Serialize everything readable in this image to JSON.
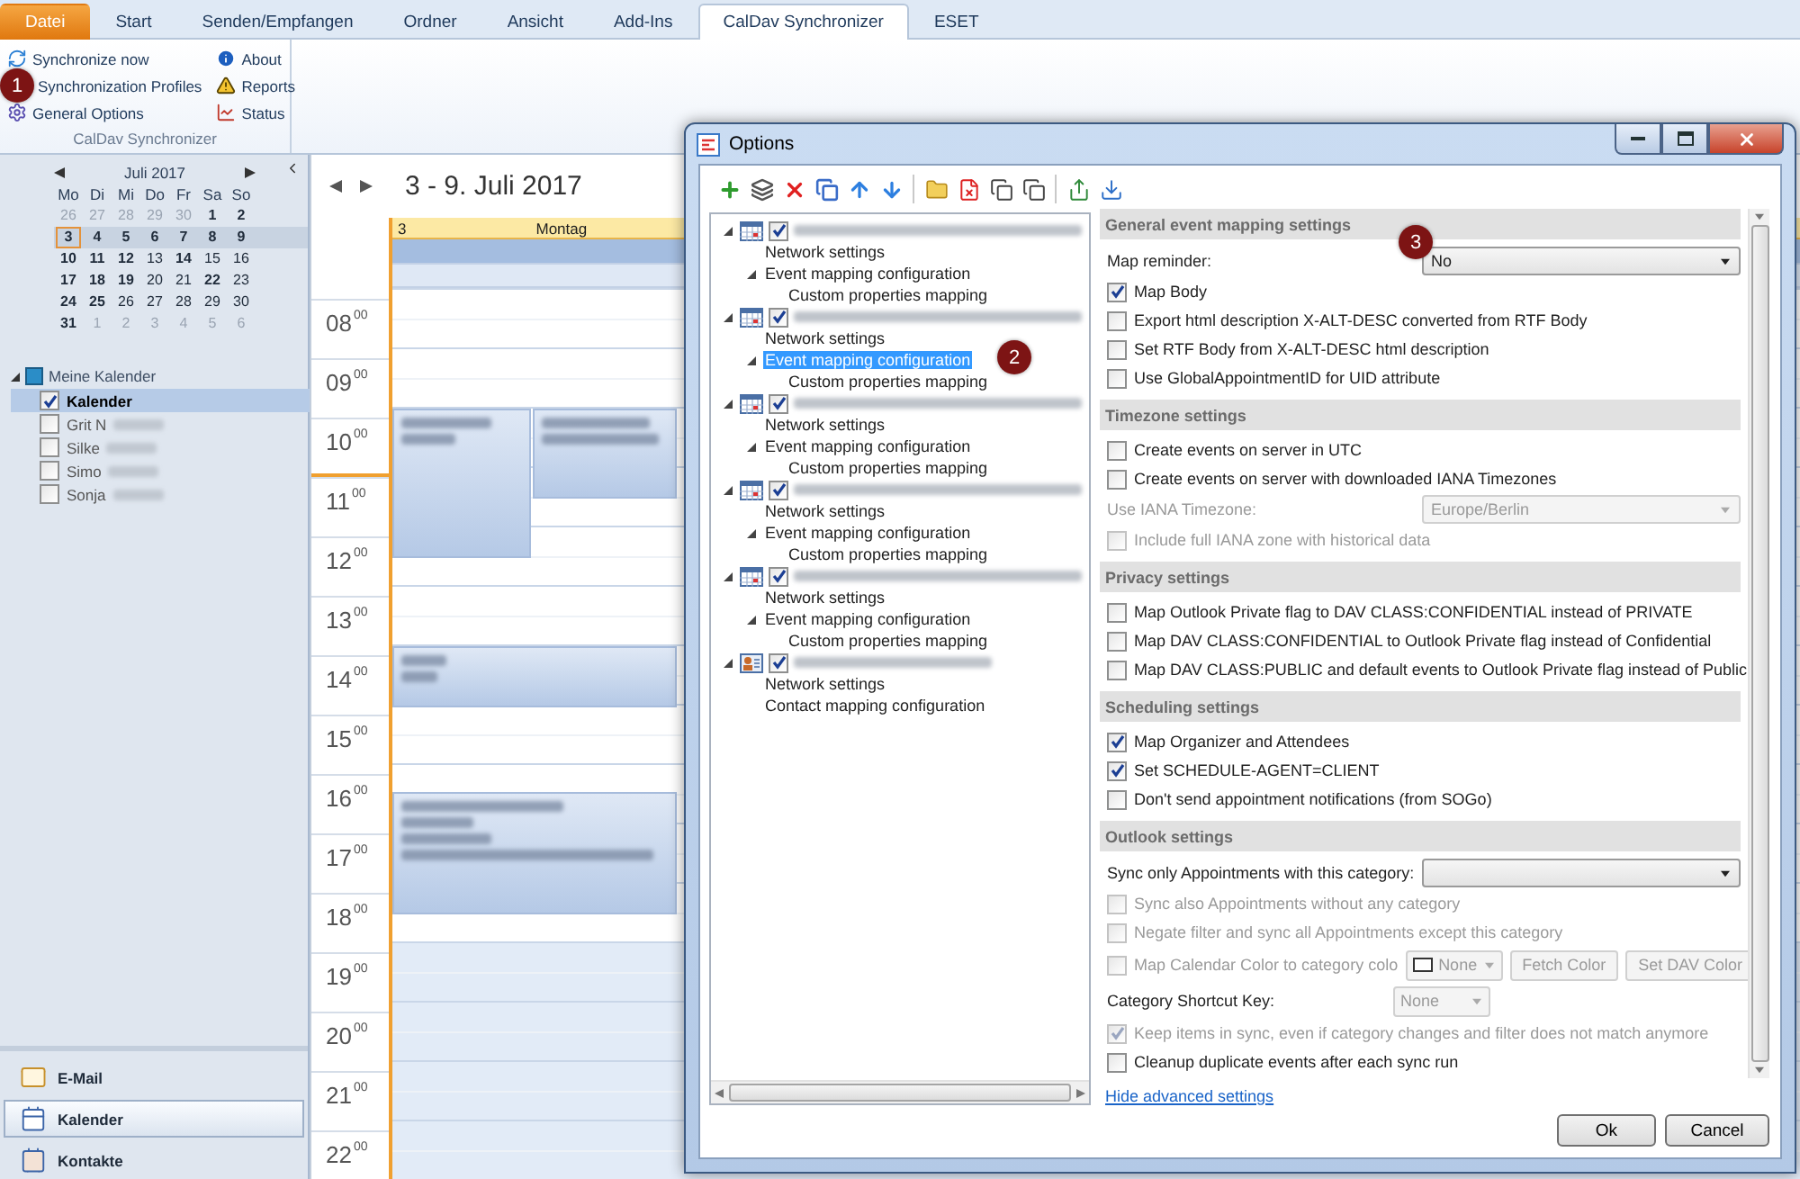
{
  "ribbon": {
    "tabs": [
      {
        "label": "Datei",
        "kind": "file",
        "selected": false
      },
      {
        "label": "Start",
        "kind": "tab",
        "selected": false
      },
      {
        "label": "Senden/Empfangen",
        "kind": "tab",
        "selected": false
      },
      {
        "label": "Ordner",
        "kind": "tab",
        "selected": false
      },
      {
        "label": "Ansicht",
        "kind": "tab",
        "selected": false
      },
      {
        "label": "Add-Ins",
        "kind": "tab",
        "selected": false
      },
      {
        "label": "CalDav Synchronizer",
        "kind": "tab",
        "selected": true
      },
      {
        "label": "ESET",
        "kind": "tab",
        "selected": false
      }
    ],
    "group": {
      "title": "CalDav Synchronizer",
      "items": [
        {
          "label": "Synchronize now"
        },
        {
          "label": "Synchronization Profiles"
        },
        {
          "label": "General Options"
        },
        {
          "label": "About"
        },
        {
          "label": "Reports"
        },
        {
          "label": "Status"
        }
      ]
    }
  },
  "callouts": [
    "1",
    "2",
    "3"
  ],
  "navigation": {
    "mini_calendar": {
      "month": "Juli 2017",
      "weekdays": [
        "Mo",
        "Di",
        "Mi",
        "Do",
        "Fr",
        "Sa",
        "So"
      ],
      "weeks": [
        {
          "selected": false,
          "days": [
            {
              "day": "26",
              "muted": true,
              "bold": false,
              "today": false
            },
            {
              "day": "27",
              "muted": true,
              "bold": false,
              "today": false
            },
            {
              "day": "28",
              "muted": true,
              "bold": false,
              "today": false
            },
            {
              "day": "29",
              "muted": true,
              "bold": false,
              "today": false
            },
            {
              "day": "30",
              "muted": true,
              "bold": false,
              "today": false
            },
            {
              "day": "1",
              "muted": false,
              "bold": true,
              "today": false
            },
            {
              "day": "2",
              "muted": false,
              "bold": true,
              "today": false
            }
          ]
        },
        {
          "selected": true,
          "days": [
            {
              "day": "3",
              "muted": false,
              "bold": true,
              "today": true
            },
            {
              "day": "4",
              "muted": false,
              "bold": true,
              "today": false
            },
            {
              "day": "5",
              "muted": false,
              "bold": true,
              "today": false
            },
            {
              "day": "6",
              "muted": false,
              "bold": true,
              "today": false
            },
            {
              "day": "7",
              "muted": false,
              "bold": true,
              "today": false
            },
            {
              "day": "8",
              "muted": false,
              "bold": true,
              "today": false
            },
            {
              "day": "9",
              "muted": false,
              "bold": true,
              "today": false
            }
          ]
        },
        {
          "selected": false,
          "days": [
            {
              "day": "10",
              "muted": false,
              "bold": true,
              "today": false
            },
            {
              "day": "11",
              "muted": false,
              "bold": true,
              "today": false
            },
            {
              "day": "12",
              "muted": false,
              "bold": true,
              "today": false
            },
            {
              "day": "13",
              "muted": false,
              "bold": false,
              "today": false
            },
            {
              "day": "14",
              "muted": false,
              "bold": true,
              "today": false
            },
            {
              "day": "15",
              "muted": false,
              "bold": false,
              "today": false
            },
            {
              "day": "16",
              "muted": false,
              "bold": false,
              "today": false
            }
          ]
        },
        {
          "selected": false,
          "days": [
            {
              "day": "17",
              "muted": false,
              "bold": true,
              "today": false
            },
            {
              "day": "18",
              "muted": false,
              "bold": true,
              "today": false
            },
            {
              "day": "19",
              "muted": false,
              "bold": true,
              "today": false
            },
            {
              "day": "20",
              "muted": false,
              "bold": false,
              "today": false
            },
            {
              "day": "21",
              "muted": false,
              "bold": false,
              "today": false
            },
            {
              "day": "22",
              "muted": false,
              "bold": true,
              "today": false
            },
            {
              "day": "23",
              "muted": false,
              "bold": false,
              "today": false
            }
          ]
        },
        {
          "selected": false,
          "days": [
            {
              "day": "24",
              "muted": false,
              "bold": true,
              "today": false
            },
            {
              "day": "25",
              "muted": false,
              "bold": true,
              "today": false
            },
            {
              "day": "26",
              "muted": false,
              "bold": false,
              "today": false
            },
            {
              "day": "27",
              "muted": false,
              "bold": false,
              "today": false
            },
            {
              "day": "28",
              "muted": false,
              "bold": false,
              "today": false
            },
            {
              "day": "29",
              "muted": false,
              "bold": false,
              "today": false
            },
            {
              "day": "30",
              "muted": false,
              "bold": false,
              "today": false
            }
          ]
        },
        {
          "selected": false,
          "days": [
            {
              "day": "31",
              "muted": false,
              "bold": true,
              "today": false
            },
            {
              "day": "1",
              "muted": true,
              "bold": false,
              "today": false
            },
            {
              "day": "2",
              "muted": true,
              "bold": false,
              "today": false
            },
            {
              "day": "3",
              "muted": true,
              "bold": false,
              "today": false
            },
            {
              "day": "4",
              "muted": true,
              "bold": false,
              "today": false
            },
            {
              "day": "5",
              "muted": true,
              "bold": false,
              "today": false
            },
            {
              "day": "6",
              "muted": true,
              "bold": false,
              "today": false
            }
          ]
        }
      ]
    },
    "folders": {
      "title": "Meine Kalender",
      "expanded": true,
      "items": [
        {
          "label": "Kalender",
          "checked": true,
          "selected": true,
          "redacted": false
        },
        {
          "label": "Grit N",
          "checked": false,
          "selected": false,
          "redacted": true
        },
        {
          "label": "Silke",
          "checked": false,
          "selected": false,
          "redacted": true
        },
        {
          "label": "Simo",
          "checked": false,
          "selected": false,
          "redacted": true
        },
        {
          "label": "Sonja",
          "checked": false,
          "selected": false,
          "redacted": true
        }
      ]
    },
    "modules": [
      {
        "label": "E-Mail",
        "selected": false
      },
      {
        "label": "Kalender",
        "selected": true
      },
      {
        "label": "Kontakte",
        "selected": false
      }
    ]
  },
  "calendar": {
    "title": "3 - 9. Juli 2017",
    "day": {
      "number": "3",
      "name": "Montag"
    },
    "hours": [
      {
        "hour": "08",
        "minutes": "00",
        "working": true
      },
      {
        "hour": "09",
        "minutes": "00",
        "working": true
      },
      {
        "hour": "10",
        "minutes": "00",
        "working": true
      },
      {
        "hour": "11",
        "minutes": "00",
        "working": true
      },
      {
        "hour": "12",
        "minutes": "00",
        "working": true
      },
      {
        "hour": "13",
        "minutes": "00",
        "working": true
      },
      {
        "hour": "14",
        "minutes": "00",
        "working": true
      },
      {
        "hour": "15",
        "minutes": "00",
        "working": true
      },
      {
        "hour": "16",
        "minutes": "00",
        "working": true
      },
      {
        "hour": "17",
        "minutes": "00",
        "working": true
      },
      {
        "hour": "18",
        "minutes": "00",
        "working": true
      },
      {
        "hour": "19",
        "minutes": "00",
        "working": false
      },
      {
        "hour": "20",
        "minutes": "00",
        "working": false
      },
      {
        "hour": "21",
        "minutes": "00",
        "working": false
      },
      {
        "hour": "22",
        "minutes": "00",
        "working": false
      }
    ]
  },
  "dialog": {
    "title": "Options",
    "tree": [
      {
        "kind": "calendar",
        "checked": true,
        "expanded": true,
        "children": [
          {
            "label": "Network settings",
            "selected": false
          },
          {
            "label": "Event mapping configuration",
            "selected": false,
            "expanded": true,
            "children": [
              {
                "label": "Custom properties mapping",
                "selected": false
              }
            ]
          }
        ]
      },
      {
        "kind": "calendar",
        "checked": true,
        "expanded": true,
        "children": [
          {
            "label": "Network settings",
            "selected": false
          },
          {
            "label": "Event mapping configuration",
            "selected": true,
            "expanded": true,
            "children": [
              {
                "label": "Custom properties mapping",
                "selected": false
              }
            ]
          }
        ]
      },
      {
        "kind": "calendar",
        "checked": true,
        "expanded": true,
        "children": [
          {
            "label": "Network settings",
            "selected": false
          },
          {
            "label": "Event mapping configuration",
            "selected": false,
            "expanded": true,
            "children": [
              {
                "label": "Custom properties mapping",
                "selected": false
              }
            ]
          }
        ]
      },
      {
        "kind": "calendar",
        "checked": true,
        "expanded": true,
        "children": [
          {
            "label": "Network settings",
            "selected": false
          },
          {
            "label": "Event mapping configuration",
            "selected": false,
            "expanded": true,
            "children": [
              {
                "label": "Custom properties mapping",
                "selected": false
              }
            ]
          }
        ]
      },
      {
        "kind": "calendar",
        "checked": true,
        "expanded": true,
        "children": [
          {
            "label": "Network settings",
            "selected": false
          },
          {
            "label": "Event mapping configuration",
            "selected": false,
            "expanded": true,
            "children": [
              {
                "label": "Custom properties mapping",
                "selected": false
              }
            ]
          }
        ]
      },
      {
        "kind": "contacts",
        "checked": true,
        "expanded": true,
        "children": [
          {
            "label": "Network settings",
            "selected": false
          },
          {
            "label": "Contact mapping configuration",
            "selected": false
          }
        ]
      }
    ],
    "sections": [
      {
        "title": "General event mapping settings",
        "rows": [
          {
            "kind": "select",
            "label": "Map reminder:",
            "value": "No",
            "disabled": false
          },
          {
            "kind": "checkbox",
            "label": "Map Body",
            "checked": true,
            "disabled": false
          },
          {
            "kind": "checkbox",
            "label": "Export html description X-ALT-DESC converted from RTF Body",
            "checked": false,
            "disabled": false
          },
          {
            "kind": "checkbox",
            "label": "Set RTF Body from X-ALT-DESC html description",
            "checked": false,
            "disabled": false
          },
          {
            "kind": "checkbox",
            "label": "Use GlobalAppointmentID for UID attribute",
            "checked": false,
            "disabled": false
          }
        ]
      },
      {
        "title": "Timezone settings",
        "rows": [
          {
            "kind": "checkbox",
            "label": "Create events on server in UTC",
            "checked": false,
            "disabled": false
          },
          {
            "kind": "checkbox",
            "label": "Create events on server with downloaded IANA Timezones",
            "checked": false,
            "disabled": false
          },
          {
            "kind": "select",
            "label": "Use IANA Timezone:",
            "value": "Europe/Berlin",
            "disabled": true
          },
          {
            "kind": "checkbox",
            "label": "Include full IANA zone with historical data",
            "checked": false,
            "disabled": true
          }
        ]
      },
      {
        "title": "Privacy settings",
        "rows": [
          {
            "kind": "checkbox",
            "label": "Map Outlook Private flag to DAV CLASS:CONFIDENTIAL instead of PRIVATE",
            "checked": false,
            "disabled": false
          },
          {
            "kind": "checkbox",
            "label": "Map DAV CLASS:CONFIDENTIAL to Outlook Private flag instead of Confidential",
            "checked": false,
            "disabled": false
          },
          {
            "kind": "checkbox",
            "label": "Map DAV CLASS:PUBLIC and default events to Outlook Private flag instead of Public",
            "checked": false,
            "disabled": false
          }
        ]
      },
      {
        "title": "Scheduling settings",
        "rows": [
          {
            "kind": "checkbox",
            "label": "Map Organizer and Attendees",
            "checked": true,
            "disabled": false
          },
          {
            "kind": "checkbox",
            "label": "Set SCHEDULE-AGENT=CLIENT",
            "checked": true,
            "disabled": false
          },
          {
            "kind": "checkbox",
            "label": "Don't send appointment notifications (from SOGo)",
            "checked": false,
            "disabled": false
          }
        ]
      },
      {
        "title": "Outlook settings",
        "rows": [
          {
            "kind": "select",
            "label": "Sync only Appointments with this category:",
            "disabled": false
          },
          {
            "kind": "checkbox",
            "label": "Sync also Appointments without any category",
            "checked": false,
            "disabled": true
          },
          {
            "kind": "checkbox",
            "label": "Negate filter and sync all Appointments except this category",
            "checked": false,
            "disabled": true
          },
          {
            "kind": "color",
            "label": "Map Calendar Color to category colo",
            "checked": false,
            "disabled": true,
            "value": "None",
            "buttons": [
              "Fetch Color",
              "Set DAV Color"
            ]
          },
          {
            "kind": "shortcut",
            "label": "Category Shortcut Key:",
            "value": "None",
            "disabled": true
          },
          {
            "kind": "checkbox",
            "label": "Keep items in sync, even if category changes and filter does not match anymore",
            "checked": true,
            "disabled": true
          },
          {
            "kind": "checkbox",
            "label": "Cleanup duplicate events after each sync run",
            "checked": false,
            "disabled": false
          }
        ]
      }
    ],
    "link": "Hide advanced settings",
    "buttons": [
      "Ok",
      "Cancel"
    ]
  }
}
